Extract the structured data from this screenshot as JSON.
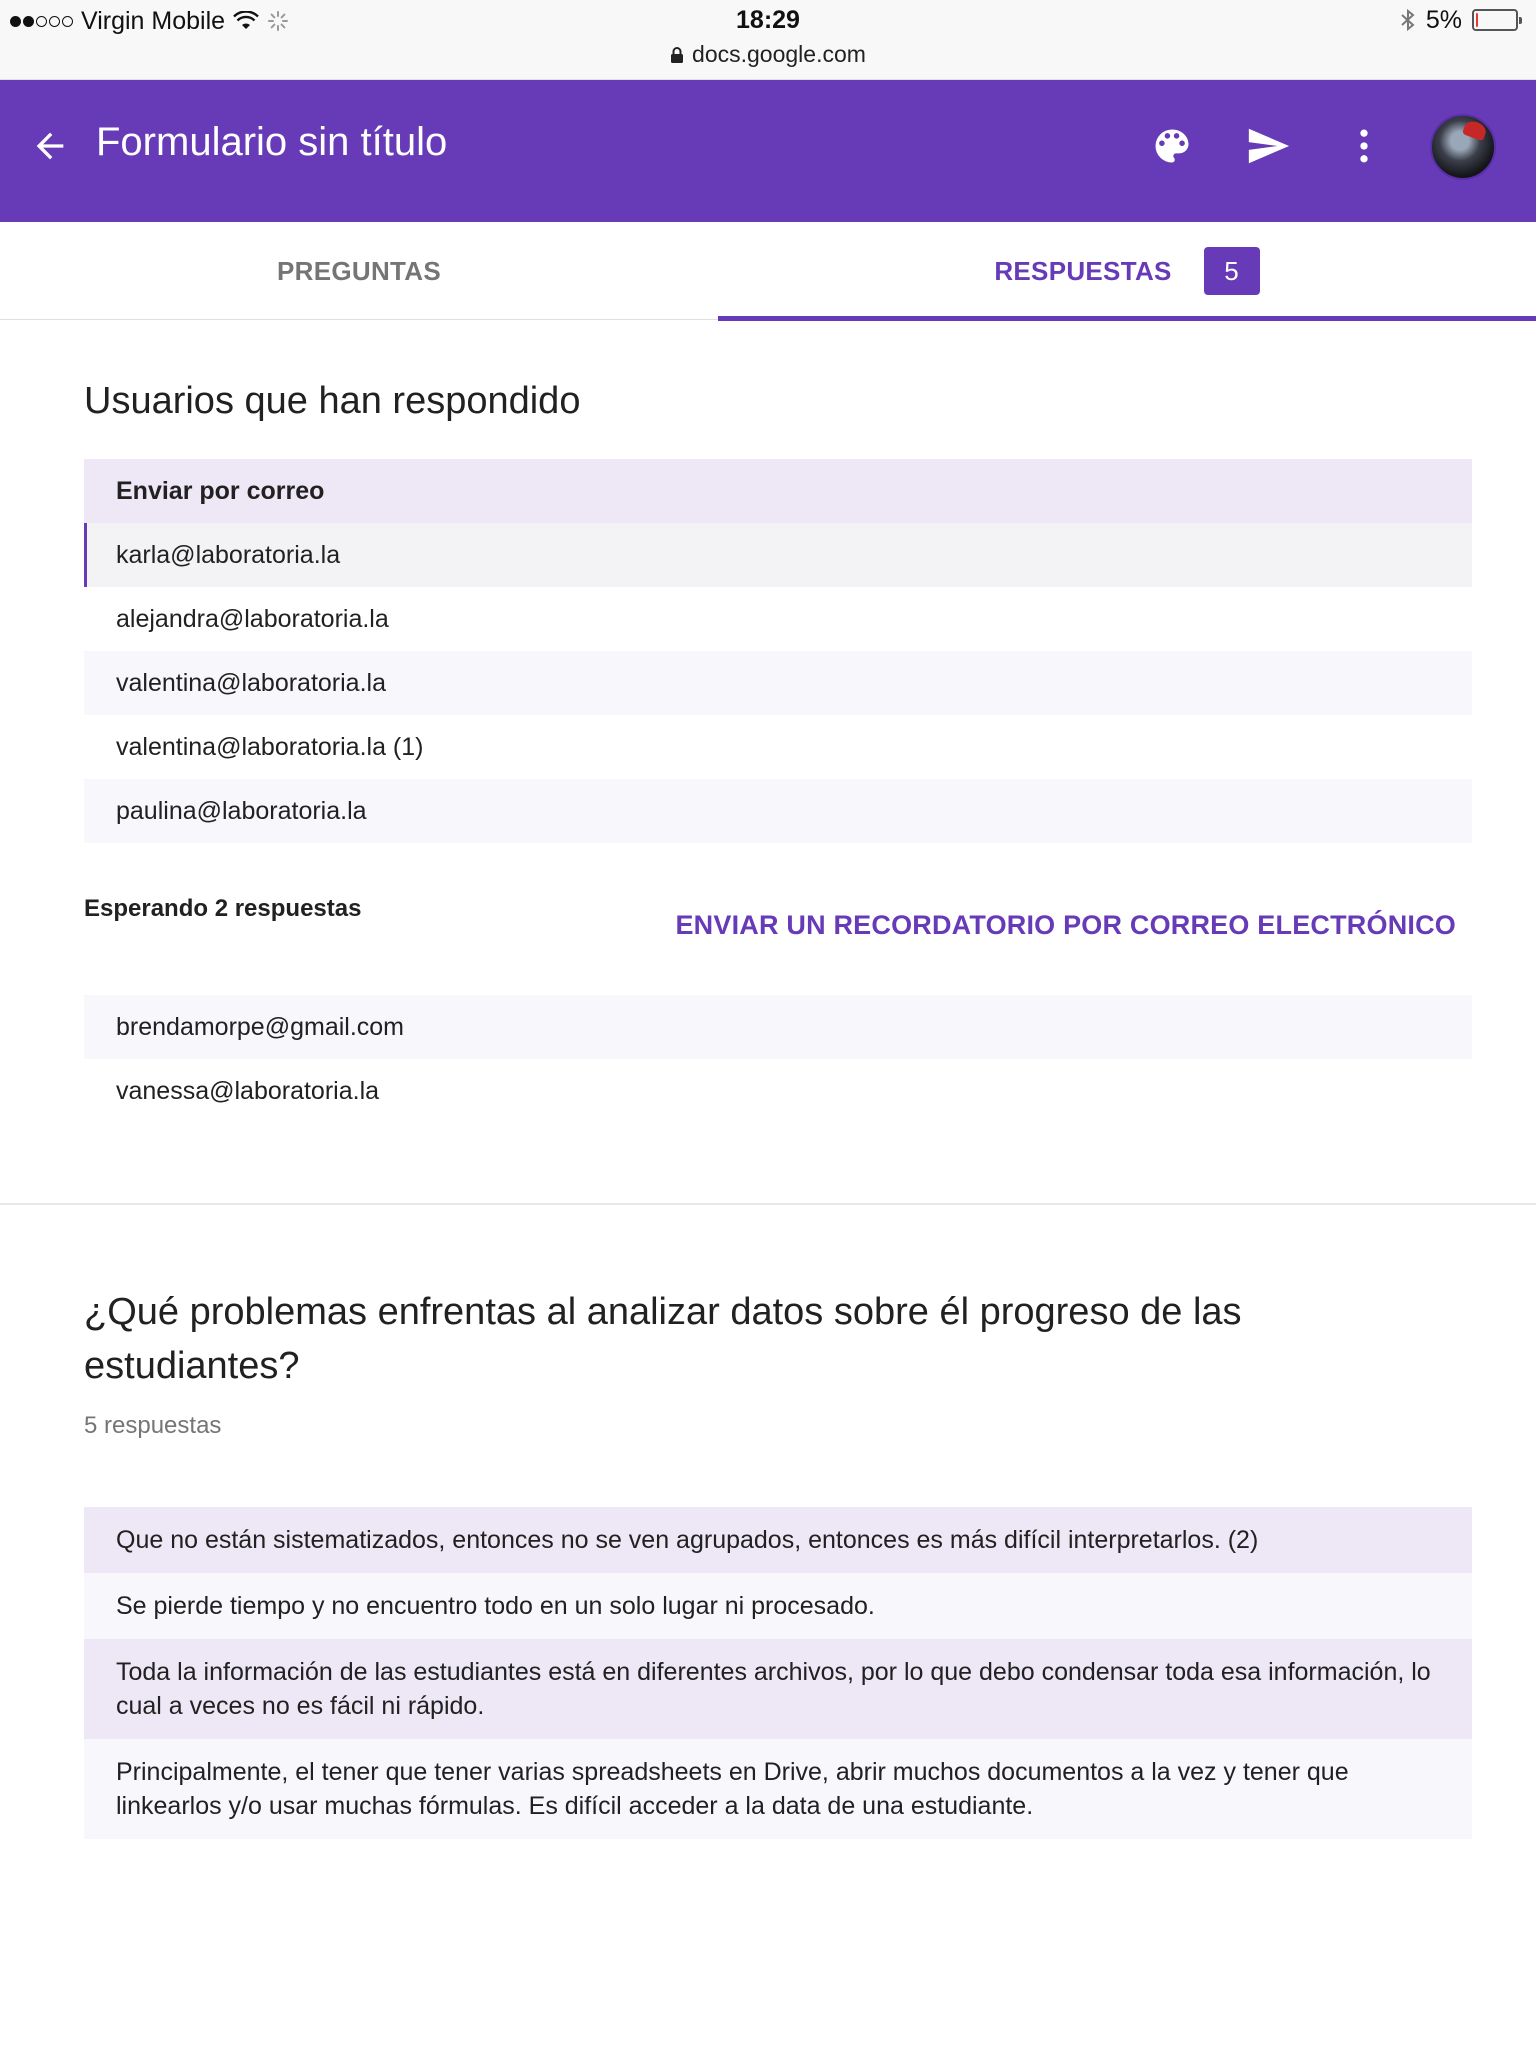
{
  "status_bar": {
    "carrier": "Virgin Mobile",
    "time": "18:29",
    "url": "docs.google.com",
    "battery": "5%",
    "battery_level": 0.05
  },
  "app_bar": {
    "title": "Formulario sin título",
    "icons": [
      "back-arrow-icon",
      "palette-icon",
      "send-icon",
      "more-vert-icon",
      "avatar"
    ]
  },
  "tabs": {
    "questions": "PREGUNTAS",
    "responses": "RESPUESTAS",
    "responses_count": "5",
    "active": "responses"
  },
  "respondents": {
    "title": "Usuarios que han respondido",
    "header": "Enviar por correo",
    "emails": [
      "karla@laboratoria.la",
      "alejandra@laboratoria.la",
      "valentina@laboratoria.la",
      "valentina@laboratoria.la (1)",
      "paulina@laboratoria.la"
    ]
  },
  "waiting": {
    "label": "Esperando 2 respuestas",
    "reminder_button": "ENVIAR UN RECORDATORIO POR CORREO ELECTRÓNICO",
    "emails": [
      "brendamorpe@gmail.com",
      "vanessa@laboratoria.la"
    ]
  },
  "question": {
    "title": "¿Qué problemas enfrentas al analizar datos sobre él progreso de las estudiantes?",
    "count": "5 respuestas",
    "answers": [
      "Que no están sistematizados, entonces no se ven agrupados, entonces es más difícil interpretarlos. (2)",
      "Se pierde tiempo y no encuentro todo en un solo lugar ni procesado.",
      "Toda la información de las estudiantes está en diferentes archivos, por lo que debo condensar toda esa información, lo cual a veces no es fácil ni rápido.",
      "Principalmente, el tener que tener varias spreadsheets en Drive, abrir muchos documentos a la vez y tener que linkearlos y/o usar muchas fórmulas. Es difícil acceder a la data de una estudiante."
    ]
  },
  "colors": {
    "accent": "#673ab7",
    "header_row": "#ede7f6",
    "alt_row": "#f8f7fc"
  }
}
